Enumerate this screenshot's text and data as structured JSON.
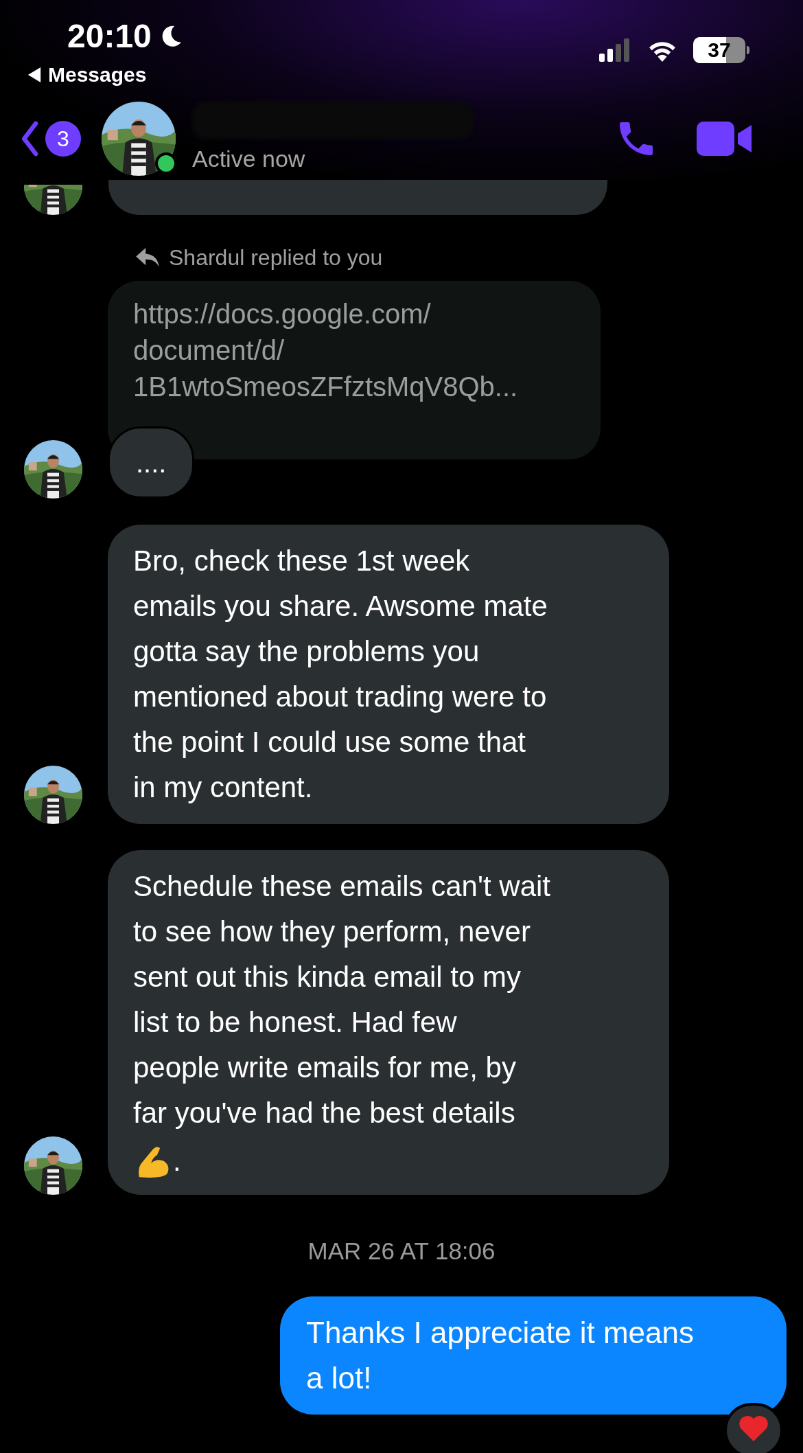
{
  "status_bar": {
    "time": "20:10",
    "back_app": "Messages",
    "battery": "37"
  },
  "header": {
    "unread_count": "3",
    "online": true,
    "presence": "Active now"
  },
  "reply_label": "Shardul replied to you",
  "messages": [
    {
      "kind": "quoted",
      "text": "https://docs.google.com/\ndocument/d/\n1B1wtoSmeosZFfztsMqV8Qb..."
    },
    {
      "kind": "received",
      "text": "....",
      "avatar": true
    },
    {
      "kind": "received",
      "text": "Bro, check these 1st week\nemails you share. Awsome mate\ngotta say the problems you\nmentioned about trading were to\nthe point I could use some that\nin my content.",
      "avatar": true
    },
    {
      "kind": "received",
      "text": "Schedule these emails can't wait\nto see how they perform, never\nsent out this kinda email to my\nlist to be honest. Had few\npeople write emails for me,  by\nfar you've had the best details",
      "end_emoji": true,
      "end_text": ".",
      "avatar": true
    },
    {
      "kind": "timestamp",
      "text": "MAR 26 AT 18:06"
    },
    {
      "kind": "sent",
      "text": "Thanks I appreciate it means\na lot!",
      "heart_reaction": true
    }
  ]
}
